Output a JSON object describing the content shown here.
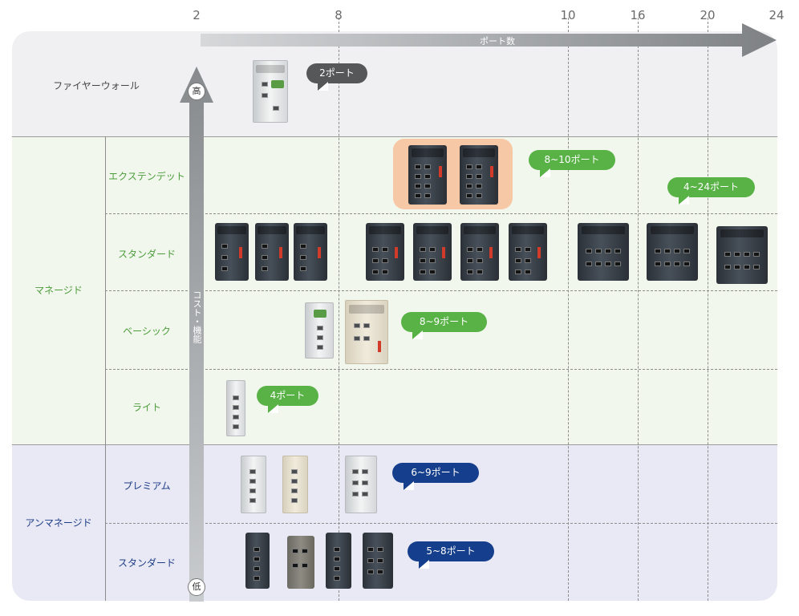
{
  "axis": {
    "title": "ポート数",
    "ticks": [
      "2",
      "8",
      "10",
      "16",
      "20",
      "24"
    ]
  },
  "vertical_axis": {
    "label_high": "高",
    "label_low": "低",
    "title": "コスト・機能"
  },
  "categories": {
    "firewall": "ファイヤーウォール",
    "managed": "マネージド",
    "unmanaged": "アンマネージド"
  },
  "subcategories": {
    "extended": "エクステンデット",
    "standard": "スタンダード",
    "basic": "ベーシック",
    "lite": "ライト",
    "premium": "プレミアム",
    "unmanaged_standard": "スタンダード"
  },
  "port_bubbles": {
    "firewall": "2ポート",
    "extended": "8~10ポート",
    "standard": "4~24ポート",
    "basic": "8~9ポート",
    "lite": "4ポート",
    "premium": "6~9ポート",
    "unmanaged_standard": "5~8ポート"
  },
  "colors": {
    "firewall_band": "#f0f0f2",
    "managed_band": "#f1f7ec",
    "unmanaged_band": "#e9e9f5",
    "green_accent": "#58b246",
    "navy_accent": "#153e8c",
    "gray_accent": "#555759",
    "arrow": "#8a8d90",
    "highlight": "#f7c8a5"
  }
}
